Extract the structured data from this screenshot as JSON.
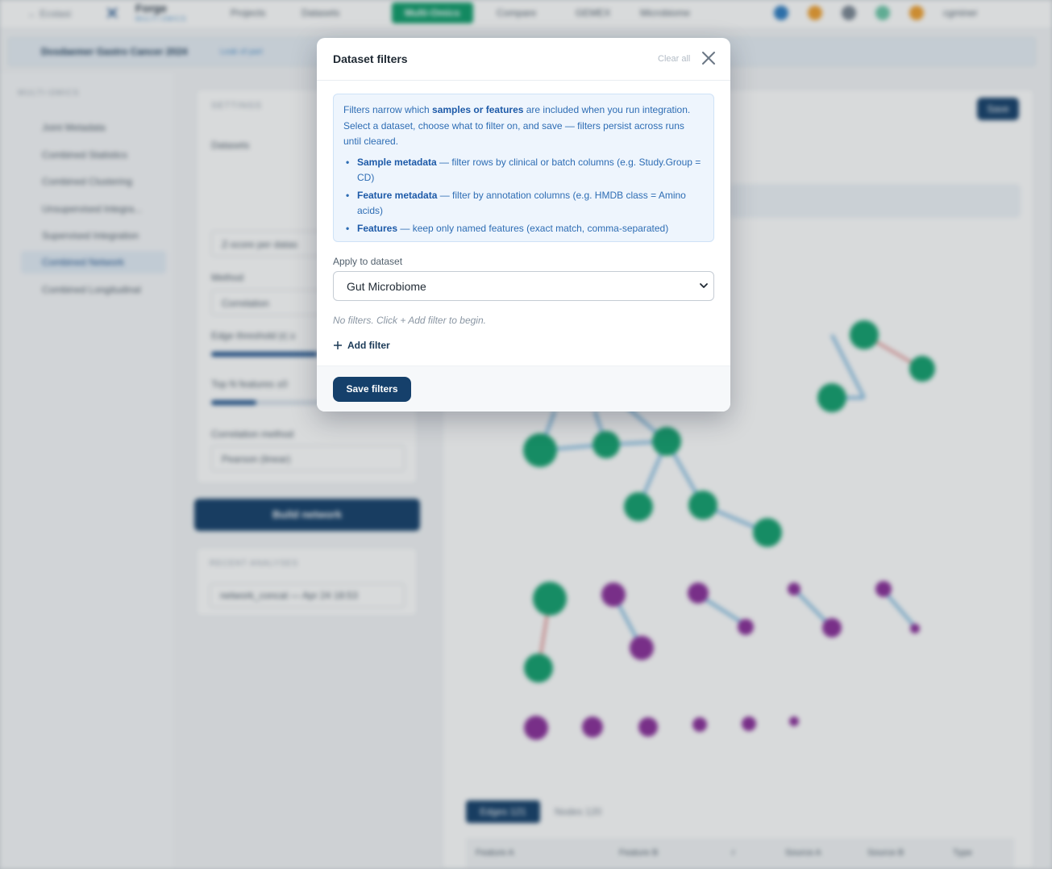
{
  "background": {
    "nav": {
      "back_label": "← Ecstasi",
      "logo_title": "Forge",
      "logo_subtitle": "MULTI-OMICS",
      "tabs": [
        "Projects",
        "Datasets",
        "Multi-Omics",
        "Compare",
        "GEMEX",
        "Microbiome"
      ],
      "active_tab": "Multi-Omics",
      "user": "cgminer"
    },
    "project": {
      "name": "Dosdaemer Gastro Cancer 2024",
      "link": "Leak of part"
    },
    "sidebar": {
      "heading": "MULTI-OMICS",
      "items": [
        "Joint Metadata",
        "Combined Statistics",
        "Combined Clustering",
        "Unsupervised Integra...",
        "Supervised Integration",
        "Combined Network",
        "Combined Longitudinal"
      ],
      "active_item": "Combined Network"
    },
    "settings": {
      "title": "SETTINGS",
      "datasets_label": "Datasets",
      "method_label": "Method",
      "method_value": "Correlation",
      "scaling_value": "Z-score per datas",
      "threshold_label": "Edge threshold |r| ≥",
      "topn_label": "Top N features ±0",
      "corr_label": "Correlation method",
      "corr_value": "Pearson (linear)",
      "build_label": "Build network",
      "recent_title": "RECENT ANALYSES",
      "recent_value": "network_concat — Apr 24 18:53"
    },
    "main": {
      "save_label": "Save",
      "edges_tab": "Edges 121",
      "nodes_tab": "Nodes 120",
      "columns": [
        "Feature A",
        "Feature B",
        "r",
        "Source A",
        "Source B",
        "Type"
      ]
    }
  },
  "modal": {
    "title": "Dataset filters",
    "clear_all": "Clear all",
    "info": {
      "intro_pre": "Filters narrow which ",
      "intro_bold": "samples or features",
      "intro_post": " are included when you run integration. Select a dataset, choose what to filter on, and save — filters persist across runs until cleared.",
      "bullets": [
        {
          "term": "Sample metadata",
          "desc": " — filter rows by clinical or batch columns (e.g. Study.Group = CD)"
        },
        {
          "term": "Feature metadata",
          "desc": " — filter by annotation columns (e.g. HMDB class = Amino acids)"
        },
        {
          "term": "Features",
          "desc": " — keep only named features (exact match, comma-separated)"
        }
      ]
    },
    "apply_label": "Apply to dataset",
    "dataset_selected": "Gut Microbiome",
    "empty_text": "No filters. Click + Add filter to begin.",
    "add_filter_label": "Add filter",
    "save_label": "Save filters"
  },
  "colors": {
    "primary": "#15406b",
    "accent_green": "#0f9d6b",
    "node_green": "#13a06e",
    "node_purple": "#8a2f9a",
    "info_bg": "#eef5fd",
    "info_text": "#2e6db4"
  }
}
